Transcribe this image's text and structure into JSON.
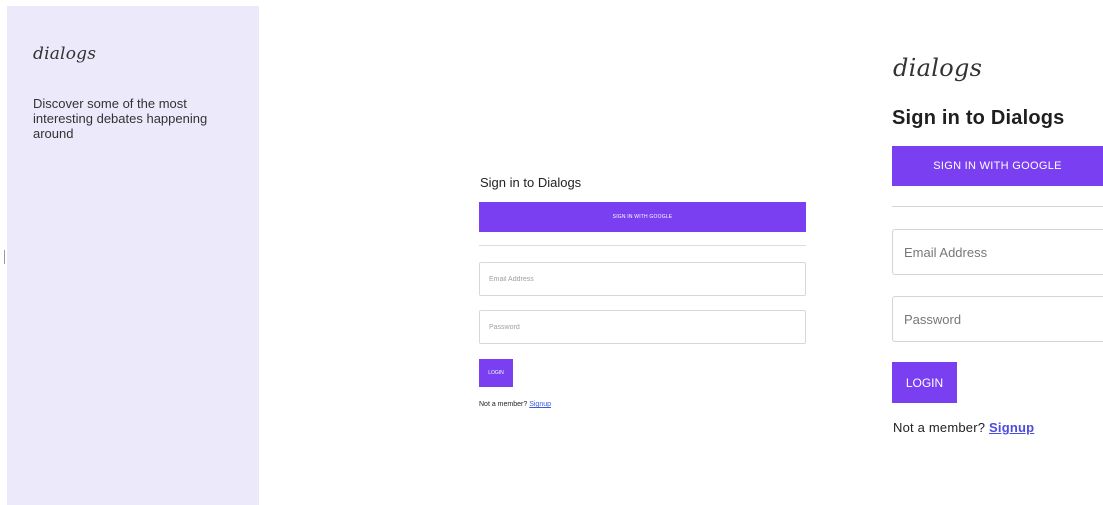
{
  "left_panel": {
    "brand": "dialogs",
    "tagline": "Discover some of the most interesting debates happening around"
  },
  "small_form": {
    "title": "Sign in to Dialogs",
    "google_button": "SIGN IN WITH GOOGLE",
    "email_placeholder": "Email Address",
    "password_placeholder": "Password",
    "login_button": "LOGIN",
    "member_text": "Not a member?",
    "signup_link": "Signup"
  },
  "large_form": {
    "brand": "dialogs",
    "title": "Sign in to Dialogs",
    "google_button": "SIGN IN WITH GOOGLE",
    "email_placeholder": "Email Address",
    "password_placeholder": "Password",
    "login_button": "LOGIN",
    "member_text": "Not a member?",
    "signup_link": "Signup"
  },
  "colors": {
    "accent": "#7b3ff2",
    "panel_background": "#ece9fb",
    "link": "#4c4ce0"
  }
}
